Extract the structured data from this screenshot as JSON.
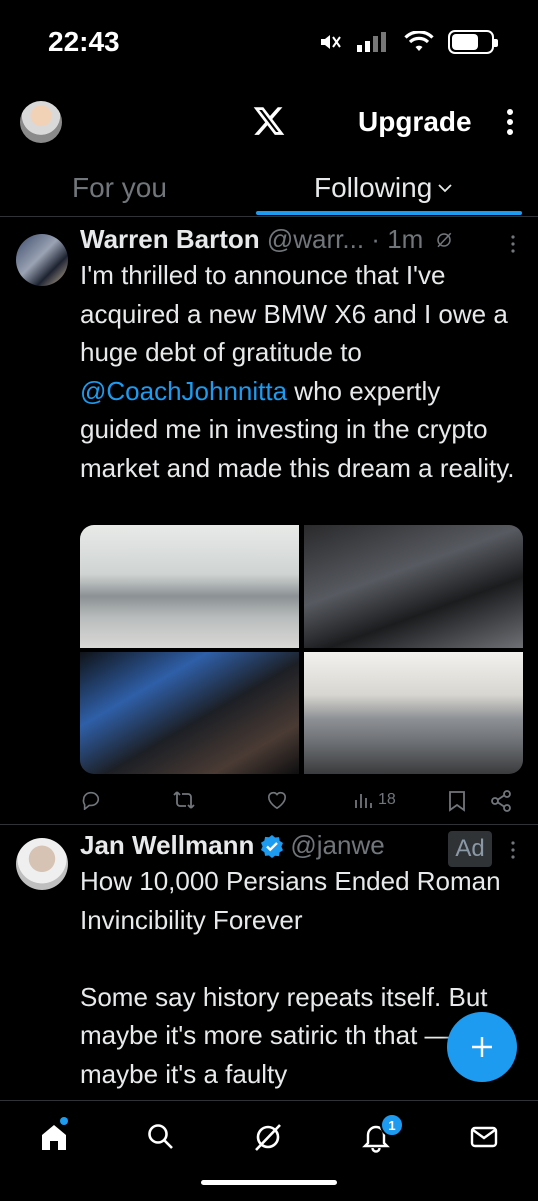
{
  "status_bar": {
    "time": "22:43",
    "icons": [
      "mute-icon",
      "signal-icon",
      "wifi-icon",
      "battery-icon"
    ]
  },
  "header": {
    "upgrade_label": "Upgrade",
    "logo": "x-logo-icon"
  },
  "tabs": [
    {
      "label": "For you",
      "active": false
    },
    {
      "label": "Following",
      "active": true
    }
  ],
  "colors": {
    "accent": "#1d9bf0",
    "muted": "#71767b",
    "divider": "#2f3336",
    "text": "#e7e9ea",
    "background": "#000000"
  },
  "tweets": [
    {
      "author": "Warren Barton",
      "handle": "@warr...",
      "time_sep": "·",
      "time": "1m",
      "text_before": "I'm thrilled to announce that I've acquired a new BMW X6 and I owe a huge debt of gratitude to ",
      "mention": "@CoachJohnnitta",
      "text_after": " who expertly guided me in investing in the crypto market and made this dream a reality.",
      "media_count": 4,
      "views": "18"
    },
    {
      "author": "Jan Wellmann",
      "handle": "@janwe",
      "verified": true,
      "ad_label": "Ad",
      "text": "How 10,000 Persians Ended Roman Invincibility Forever\n\nSome say history repeats itself. But maybe it's more satiric th that — maybe it's a faulty"
    }
  ],
  "bottom_nav": {
    "items": [
      "home-icon",
      "search-icon",
      "grok-icon",
      "notifications-icon",
      "messages-icon"
    ],
    "notification_count": "1"
  }
}
